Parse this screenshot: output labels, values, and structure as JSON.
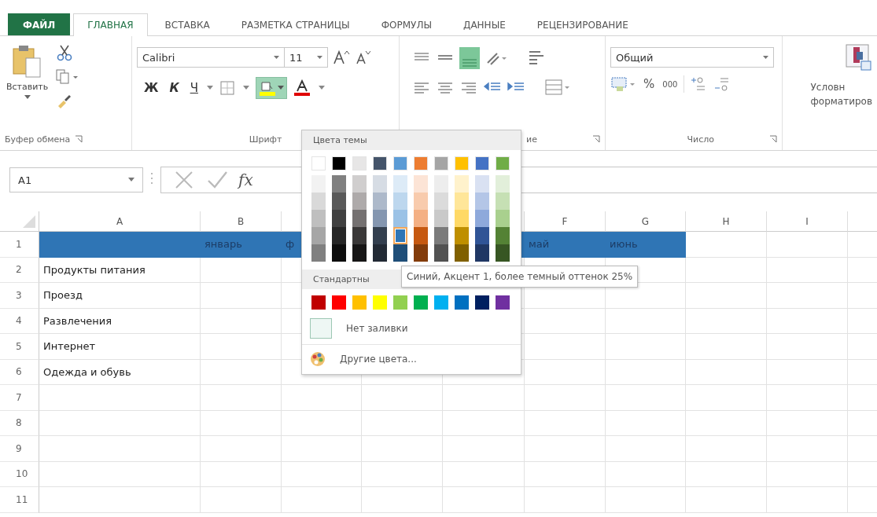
{
  "tabs": [
    {
      "label": "ФАЙЛ",
      "kind": "file",
      "selected": false
    },
    {
      "label": "ГЛАВНАЯ",
      "kind": "tab",
      "selected": true
    },
    {
      "label": "ВСТАВКА",
      "kind": "tab",
      "selected": false
    },
    {
      "label": "РАЗМЕТКА СТРАНИЦЫ",
      "kind": "tab",
      "selected": false
    },
    {
      "label": "ФОРМУЛЫ",
      "kind": "tab",
      "selected": false
    },
    {
      "label": "ДАННЫЕ",
      "kind": "tab",
      "selected": false
    },
    {
      "label": "РЕЦЕНЗИРОВАНИЕ",
      "kind": "tab",
      "selected": false
    }
  ],
  "ribbon": {
    "clipboard": {
      "paste": "Вставить",
      "label": "Буфер обмена"
    },
    "font": {
      "name": "Calibri",
      "size": "11",
      "bold": "Ж",
      "italic": "К",
      "underline": "Ч",
      "label": "Шрифт",
      "fill_open": true
    },
    "alignment": {
      "label": "ие"
    },
    "number": {
      "format": "Общий",
      "percent": "%",
      "thousands": "000",
      "label": "Число"
    },
    "styles": {
      "conditional": [
        "Условн",
        "форматиров"
      ]
    }
  },
  "formula_bar": {
    "name_box": "A1",
    "fx": "fx"
  },
  "sheet": {
    "columns": [
      "A",
      "B",
      null,
      null,
      null,
      "F",
      "G",
      "H",
      "I",
      null
    ],
    "rows": [
      {
        "number": "1",
        "filled": true,
        "cells": {
          "B": "январь",
          "C": "ф",
          "F": "май",
          "G": "июнь"
        }
      },
      {
        "number": "2",
        "filled": false,
        "cells": {
          "A": "Продукты питания"
        }
      },
      {
        "number": "3",
        "filled": false,
        "cells": {
          "A": "Проезд"
        }
      },
      {
        "number": "4",
        "filled": false,
        "cells": {
          "A": "Развлечения"
        }
      },
      {
        "number": "5",
        "filled": false,
        "cells": {
          "A": "Интернет"
        }
      },
      {
        "number": "6",
        "filled": false,
        "cells": {
          "A": "Одежда и обувь"
        }
      },
      {
        "number": "7",
        "filled": false,
        "cells": {}
      },
      {
        "number": "8",
        "filled": false,
        "cells": {}
      },
      {
        "number": "9",
        "filled": false,
        "cells": {}
      },
      {
        "number": "10",
        "filled": false,
        "cells": {}
      },
      {
        "number": "11",
        "filled": false,
        "cells": {}
      }
    ]
  },
  "color_menu": {
    "theme_title": "Цвета темы",
    "theme_colors": [
      {
        "color": "#ffffff",
        "shades": [
          {
            "color": "#f2f2f2",
            "selected": false
          },
          {
            "color": "#d9d9d9",
            "selected": false
          },
          {
            "color": "#bfbfbf",
            "selected": false
          },
          {
            "color": "#a6a6a6",
            "selected": false
          },
          {
            "color": "#808080",
            "selected": false
          }
        ]
      },
      {
        "color": "#000000",
        "shades": [
          {
            "color": "#808080",
            "selected": false
          },
          {
            "color": "#595959",
            "selected": false
          },
          {
            "color": "#404040",
            "selected": false
          },
          {
            "color": "#262626",
            "selected": false
          },
          {
            "color": "#0d0d0d",
            "selected": false
          }
        ]
      },
      {
        "color": "#e7e6e6",
        "shades": [
          {
            "color": "#d0cece",
            "selected": false
          },
          {
            "color": "#aeaaaa",
            "selected": false
          },
          {
            "color": "#757171",
            "selected": false
          },
          {
            "color": "#3a3838",
            "selected": false
          },
          {
            "color": "#171616",
            "selected": false
          }
        ]
      },
      {
        "color": "#44546a",
        "shades": [
          {
            "color": "#d6dce4",
            "selected": false
          },
          {
            "color": "#adb9ca",
            "selected": false
          },
          {
            "color": "#8496b0",
            "selected": false
          },
          {
            "color": "#333f4f",
            "selected": false
          },
          {
            "color": "#222a35",
            "selected": false
          }
        ]
      },
      {
        "color": "#5b9bd5",
        "shades": [
          {
            "color": "#ddebf7",
            "selected": false
          },
          {
            "color": "#bdd7ee",
            "selected": false
          },
          {
            "color": "#9bc2e6",
            "selected": false
          },
          {
            "color": "#2f75b5",
            "selected": true
          },
          {
            "color": "#1f4e78",
            "selected": false
          }
        ]
      },
      {
        "color": "#ed7d31",
        "shades": [
          {
            "color": "#fce4d6",
            "selected": false
          },
          {
            "color": "#f8cbad",
            "selected": false
          },
          {
            "color": "#f4b084",
            "selected": false
          },
          {
            "color": "#c65911",
            "selected": false
          },
          {
            "color": "#833c0b",
            "selected": false
          }
        ]
      },
      {
        "color": "#a5a5a5",
        "shades": [
          {
            "color": "#ededed",
            "selected": false
          },
          {
            "color": "#dbdbdb",
            "selected": false
          },
          {
            "color": "#c9c9c9",
            "selected": false
          },
          {
            "color": "#7b7b7b",
            "selected": false
          },
          {
            "color": "#525252",
            "selected": false
          }
        ]
      },
      {
        "color": "#ffc000",
        "shades": [
          {
            "color": "#fff2cc",
            "selected": false
          },
          {
            "color": "#ffe699",
            "selected": false
          },
          {
            "color": "#ffd966",
            "selected": false
          },
          {
            "color": "#bf8f00",
            "selected": false
          },
          {
            "color": "#806000",
            "selected": false
          }
        ]
      },
      {
        "color": "#4472c4",
        "shades": [
          {
            "color": "#d9e1f2",
            "selected": false
          },
          {
            "color": "#b4c6e7",
            "selected": false
          },
          {
            "color": "#8ea9db",
            "selected": false
          },
          {
            "color": "#305496",
            "selected": false
          },
          {
            "color": "#203764",
            "selected": false
          }
        ]
      },
      {
        "color": "#70ad47",
        "shades": [
          {
            "color": "#e2efda",
            "selected": false
          },
          {
            "color": "#c6e0b4",
            "selected": false
          },
          {
            "color": "#a9d08e",
            "selected": false
          },
          {
            "color": "#548235",
            "selected": false
          },
          {
            "color": "#375623",
            "selected": false
          }
        ]
      }
    ],
    "standard_title": "Стандартны",
    "standard_colors": [
      {
        "color": "#c00000"
      },
      {
        "color": "#ff0000"
      },
      {
        "color": "#ffc000"
      },
      {
        "color": "#ffff00"
      },
      {
        "color": "#92d050"
      },
      {
        "color": "#00b050"
      },
      {
        "color": "#00b0f0"
      },
      {
        "color": "#0070c0"
      },
      {
        "color": "#002060"
      },
      {
        "color": "#7030a0"
      }
    ],
    "no_fill": "Нет заливки",
    "more_colors": "Другие цвета...",
    "tooltip": "Синий, Акцент 1, более темный оттенок 25%"
  }
}
